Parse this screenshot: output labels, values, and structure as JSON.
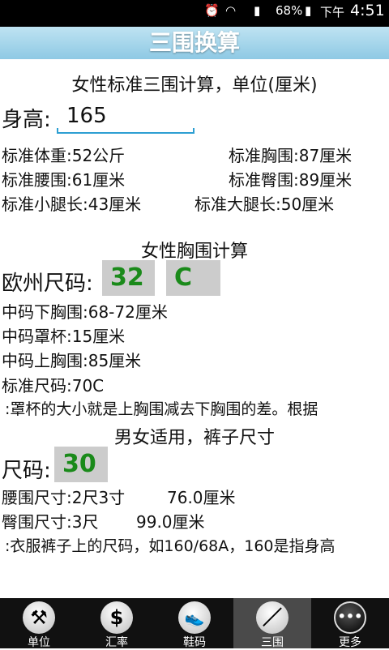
{
  "status_bar": {
    "battery": "68%",
    "period": "下午",
    "time": "4:51"
  },
  "title": "三围换算",
  "section1": {
    "heading": "女性标准三围计算，单位(厘米)",
    "height_label": "身高:",
    "height_value": "165",
    "rows": [
      {
        "left": "标准体重:52公斤",
        "right": "标准胸围:87厘米"
      },
      {
        "left": "标准腰围:61厘米",
        "right": "标准臀围:89厘米"
      },
      {
        "left": "标准小腿长:43厘米",
        "right": "标准大腿长:50厘米"
      }
    ]
  },
  "section2": {
    "heading": "女性胸围计算",
    "size_label": "欧州尺码:",
    "band_size": "32",
    "cup_size": "C",
    "lines": [
      "中码下胸围:68-72厘米",
      "中码罩杯:15厘米",
      "中码上胸围:85厘米",
      "标准尺码:70C"
    ],
    "hint": ":罩杯的大小就是上胸围减去下胸围的差。根据"
  },
  "section3": {
    "heading": "男女适用，裤子尺寸",
    "size_label": "尺码:",
    "size_value": "30",
    "waist": "腰围尺寸:2尺3寸",
    "waist_cm": "76.0厘米",
    "hip": "臀围尺寸:3尺",
    "hip_cm": "99.0厘米",
    "hint": ":衣服裤子上的尺码，如160/68A，160是指身高"
  },
  "tabs": [
    {
      "label": "单位",
      "icon": "wrench-icon",
      "glyph": "⚒"
    },
    {
      "label": "汇率",
      "icon": "dollar-icon",
      "glyph": "$"
    },
    {
      "label": "鞋码",
      "icon": "shoe-icon",
      "glyph": "👟"
    },
    {
      "label": "三围",
      "icon": "ruler-icon",
      "glyph": "／"
    },
    {
      "label": "更多",
      "icon": "more-icon",
      "glyph": "•••"
    }
  ],
  "colors": {
    "accent": "#8ec9e4",
    "size_text": "#1a8a1a",
    "size_box": "#cccccc",
    "tabbar": "#111111"
  }
}
